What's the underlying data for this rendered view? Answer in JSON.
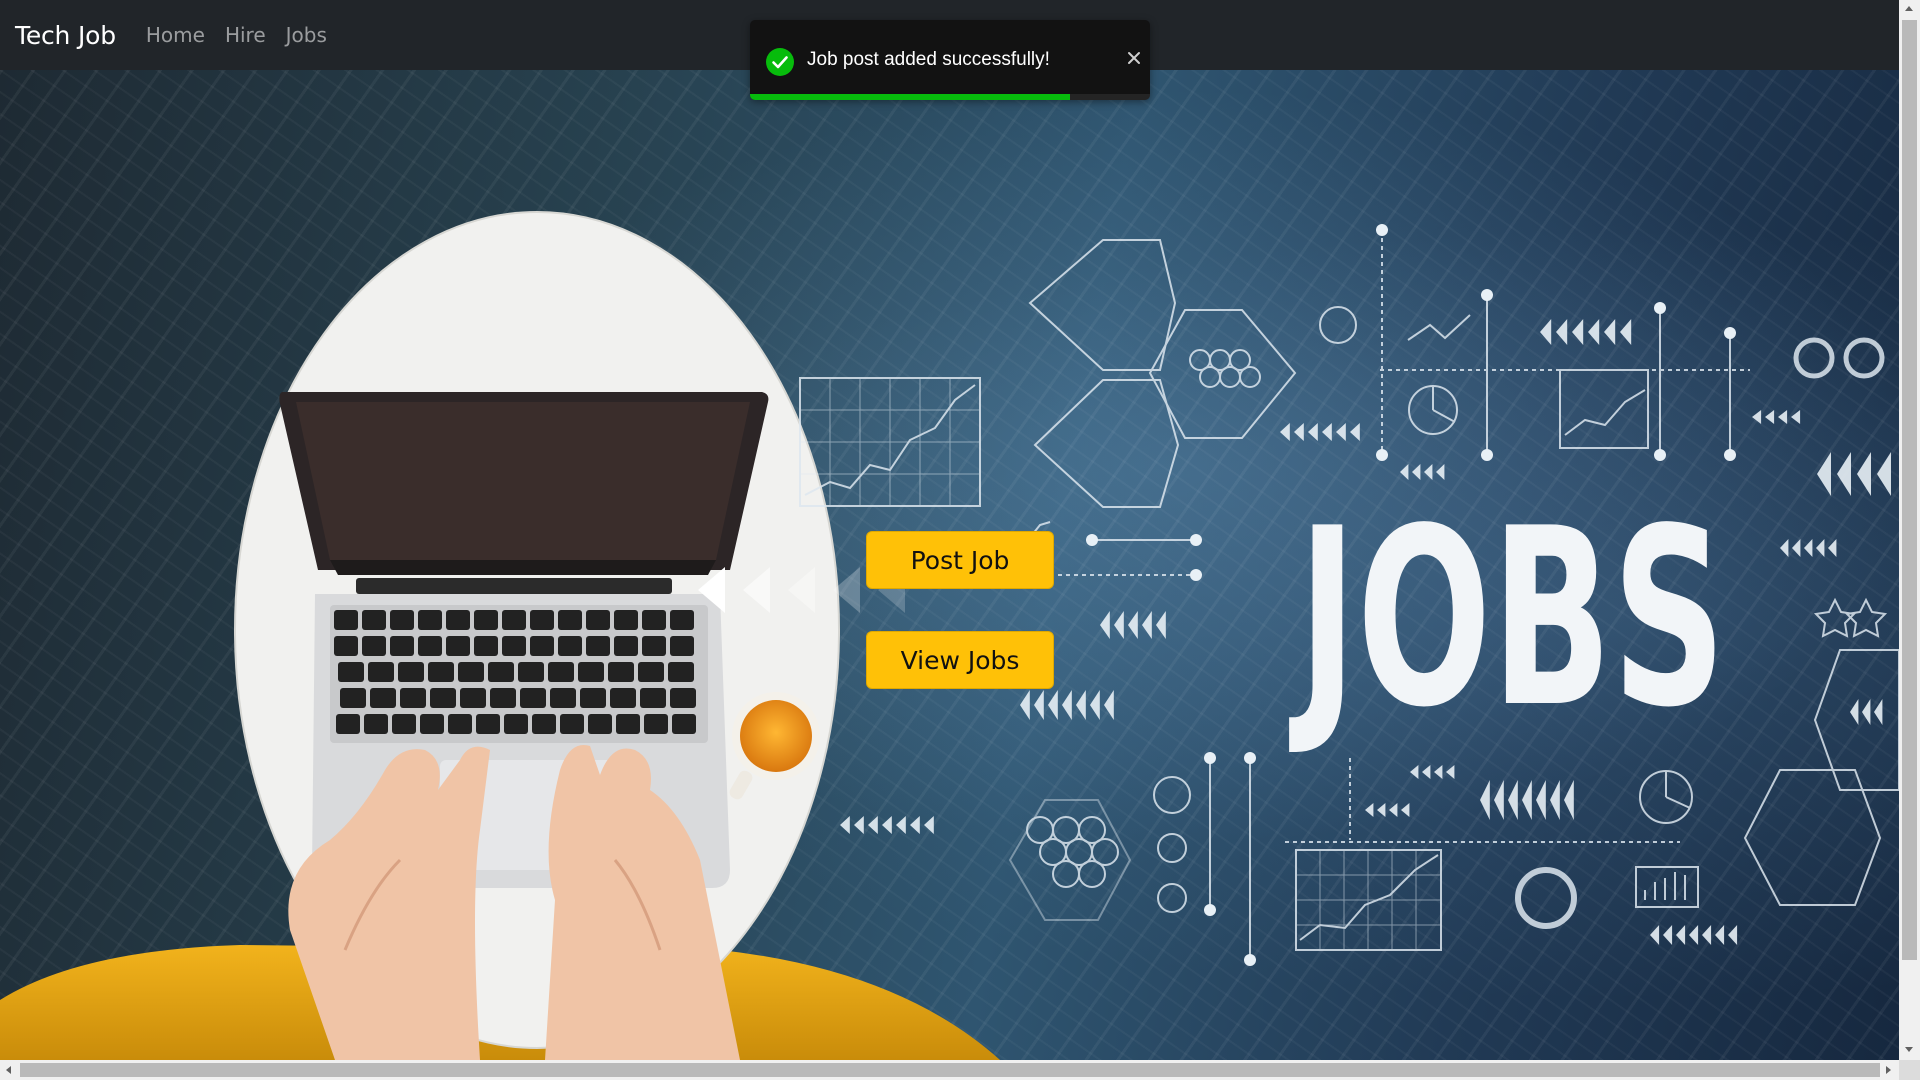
{
  "navbar": {
    "brand": "Tech Job",
    "links": [
      "Home",
      "Hire",
      "Jobs"
    ]
  },
  "hero": {
    "headline": "JOBS",
    "buttons": {
      "post_job": "Post Job",
      "view_jobs": "View Jobs"
    }
  },
  "toast": {
    "message": "Job post added successfully!",
    "type": "success",
    "progress_fraction": 0.8,
    "icons": {
      "status": "check-circle-icon",
      "close": "close-icon"
    }
  },
  "colors": {
    "navbar_bg": "#212529",
    "accent_yellow": "#ffc107",
    "toast_bg": "#121212",
    "success_green": "#07bc0c"
  }
}
